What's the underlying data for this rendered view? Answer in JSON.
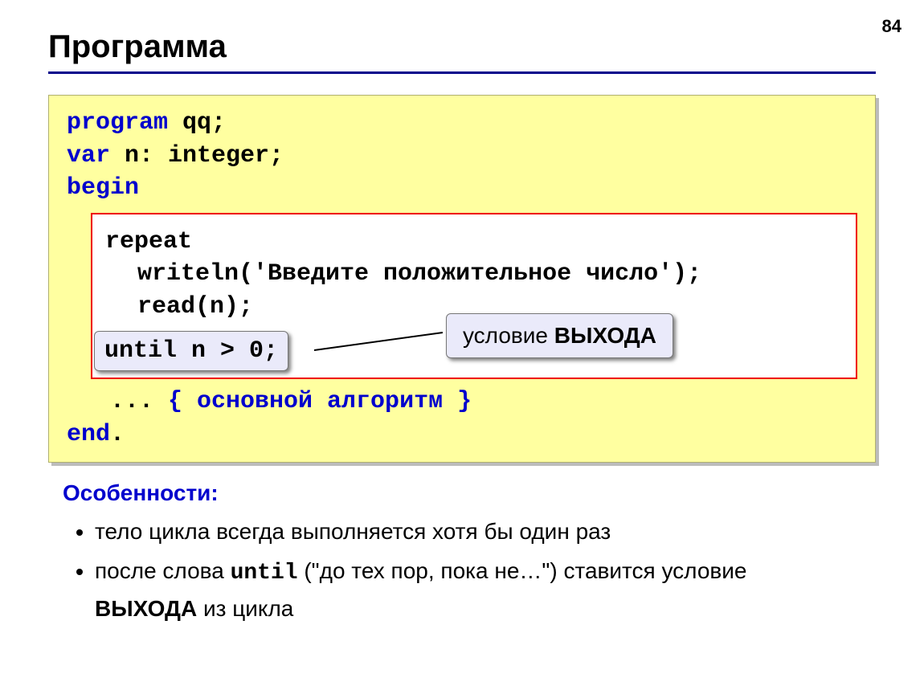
{
  "page_number": "84",
  "title": "Программа",
  "code": {
    "l1_kw": "program",
    "l1_rest": " qq;",
    "l2_kw": "var",
    "l2_rest": " n: integer;",
    "l3_kw": "begin",
    "box_l1": "repeat",
    "box_l2": "writeln('Введите положительное число');",
    "box_l3": "read(n);",
    "until_badge": "until n > 0;",
    "l4_dots": "... ",
    "l4_comment": "{ основной алгоритм }",
    "l5_kw": "end",
    "l5_rest": "."
  },
  "callout": {
    "prefix": "условие ",
    "bold": "ВЫХОДА"
  },
  "features": {
    "heading": "Особенности:",
    "b1": "тело цикла всегда выполняется хотя бы один раз",
    "b2_a": "после слова ",
    "b2_mono": "until",
    "b2_b": " (\"до тех пор, пока не…\") ставится условие ",
    "b2_bold": "ВЫХОДА",
    "b2_c": " из цикла"
  }
}
